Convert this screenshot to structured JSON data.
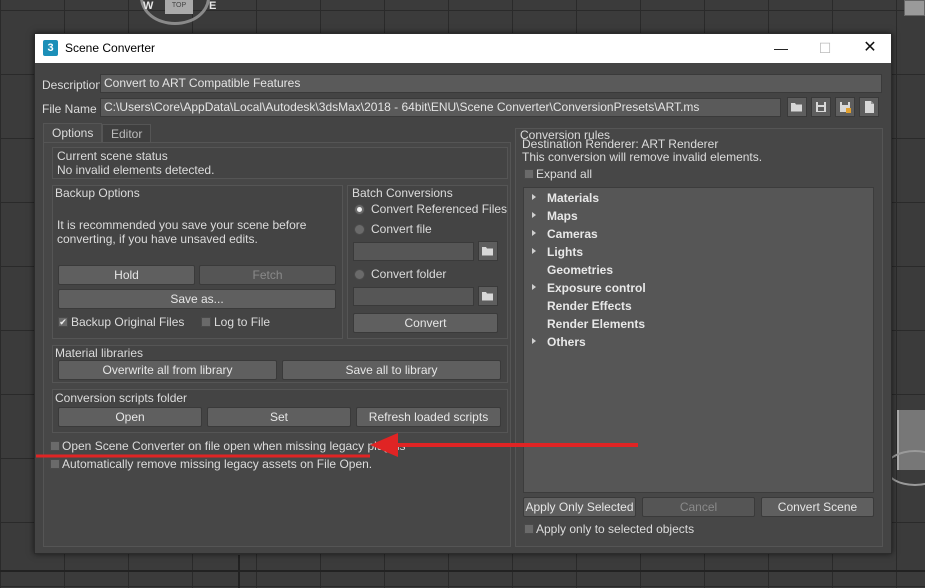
{
  "viewport": {
    "compass_w": "W",
    "compass_e": "E",
    "viewcube_top": "TOP"
  },
  "window": {
    "title": "Scene Converter",
    "app_icon": "3",
    "controls": {
      "minimize": "—",
      "maximize": "☐",
      "close": "✕"
    }
  },
  "header": {
    "description_label": "Description",
    "description_value": "Convert to ART Compatible Features",
    "filename_label": "File Name",
    "filename_value": "C:\\Users\\Core\\AppData\\Local\\Autodesk\\3dsMax\\2018 - 64bit\\ENU\\Scene Converter\\ConversionPresets\\ART.ms",
    "file_icons": [
      "open-folder-icon",
      "save-icon",
      "save-as-icon",
      "new-file-icon"
    ]
  },
  "tabs": [
    {
      "label": "Options",
      "active": true
    },
    {
      "label": "Editor",
      "active": false
    }
  ],
  "scene_status": {
    "title": "Current scene status",
    "message": "No invalid elements detected."
  },
  "backup": {
    "title": "Backup Options",
    "recommendation_line1": "It is recommended you save your scene before",
    "recommendation_line2": "converting, if you have unsaved edits.",
    "hold_label": "Hold",
    "fetch_label": "Fetch",
    "save_as_label": "Save as...",
    "backup_original_label": "Backup Original Files",
    "backup_original_checked": true,
    "log_to_file_label": "Log to File",
    "log_to_file_checked": false
  },
  "batch": {
    "title": "Batch Conversions",
    "option_referenced": "Convert Referenced Files",
    "option_file": "Convert file",
    "option_folder": "Convert folder",
    "selected": "Convert Referenced Files",
    "file_value": "",
    "folder_value": "",
    "convert_label": "Convert"
  },
  "material_libraries": {
    "title": "Material libraries",
    "overwrite_label": "Overwrite all from library",
    "save_all_label": "Save all to library"
  },
  "scripts_folder": {
    "title": "Conversion scripts folder",
    "open_label": "Open",
    "set_label": "Set",
    "refresh_label": "Refresh loaded scripts"
  },
  "options": {
    "open_on_file_open_label": "Open Scene Converter on file open when missing legacy plugins",
    "open_on_file_open_checked": false,
    "auto_remove_label": "Automatically remove missing legacy assets on File Open.",
    "auto_remove_checked": false
  },
  "rules": {
    "title": "Conversion rules",
    "destination": "Destination Renderer: ART Renderer",
    "info": "This conversion will remove invalid elements.",
    "expand_all_label": "Expand all",
    "expand_all_checked": false,
    "items": [
      {
        "label": "Materials",
        "expandable": true
      },
      {
        "label": "Maps",
        "expandable": true
      },
      {
        "label": "Cameras",
        "expandable": true
      },
      {
        "label": "Lights",
        "expandable": true
      },
      {
        "label": "Geometries",
        "expandable": false
      },
      {
        "label": "Exposure control",
        "expandable": true
      },
      {
        "label": "Render Effects",
        "expandable": false
      },
      {
        "label": "Render Elements",
        "expandable": false
      },
      {
        "label": "Others",
        "expandable": true
      }
    ],
    "apply_selected_label": "Apply Only Selected",
    "cancel_label": "Cancel",
    "convert_scene_label": "Convert Scene",
    "selected_only_label": "Apply only to selected objects",
    "selected_only_checked": false
  },
  "annotation": {
    "arrow_color": "#e02424"
  }
}
